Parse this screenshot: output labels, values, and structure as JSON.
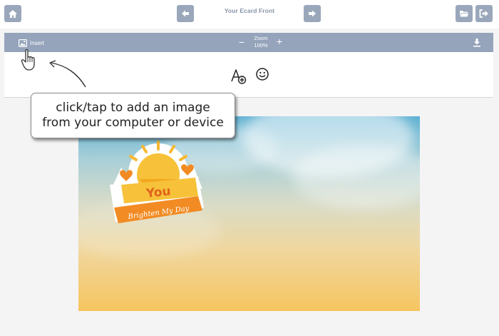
{
  "header": {
    "title": "Your Ecard Front",
    "buttons": {
      "home": "home-icon",
      "previous": "arrow-left-icon",
      "next": "arrow-right-icon",
      "open": "folder-open-icon",
      "exit": "sign-out-icon"
    }
  },
  "toolbar": {
    "insert_label": "Insert",
    "zoom_label": "Zoom",
    "zoom_value": "100%",
    "zoom_out": "−",
    "zoom_in": "+",
    "download": "download-icon"
  },
  "tools": {
    "add_text": "add-text-icon",
    "add_emoji": "smiley-icon"
  },
  "tooltip": {
    "text": "click/tap to add an image\nfrom your computer or device"
  },
  "canvas": {
    "sticker": {
      "line1": "You",
      "line2": "Brighten My Day"
    }
  },
  "colors": {
    "toolbar": "#95a4bb",
    "button": "#9aa7bb",
    "sticker_orange": "#f28b23",
    "sticker_yellow": "#f7c23a"
  }
}
